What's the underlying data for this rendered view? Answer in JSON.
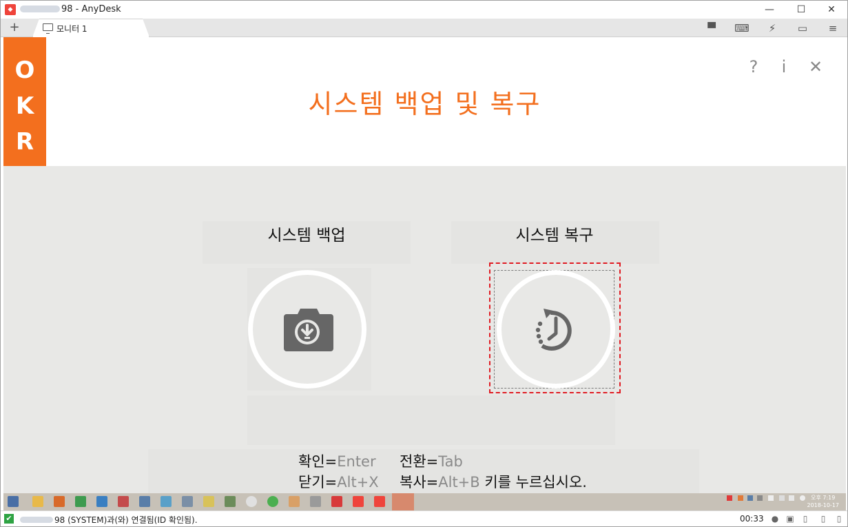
{
  "window": {
    "title_suffix": "98 - AnyDesk",
    "minimize": "—",
    "maximize": "☐",
    "close": "✕"
  },
  "tabs": {
    "add": "+",
    "items": [
      {
        "label": "모니터 1"
      }
    ]
  },
  "toolbar": {
    "chat": "▀",
    "keyboard": "⌨",
    "actions": "⚡",
    "display": "▭",
    "menu": "≡"
  },
  "app": {
    "logo_letters": [
      "O",
      "K",
      "R"
    ],
    "title": "시스템 백업 및 복구",
    "help": "?",
    "info": "i",
    "close": "✕",
    "options": [
      {
        "label": "시스템 백업",
        "icon": "camera-download-icon"
      },
      {
        "label": "시스템 복구",
        "icon": "clock-restore-icon"
      }
    ],
    "hints": {
      "line1_a_label": "확인=",
      "line1_a_key": "Enter",
      "line1_b_label": "전환=",
      "line1_b_key": "Tab",
      "line2_a_label": "닫기=",
      "line2_a_key": "Alt+X",
      "line2_b_label": "복사=",
      "line2_b_key": "Alt+B",
      "line2_suffix": " 키를 누르십시오."
    }
  },
  "taskbar": {
    "clock_time": "오후 7:19",
    "clock_date": "2018-10-17"
  },
  "status": {
    "text": "98 (SYSTEM)과(와) 연결됨(ID 확인됨).",
    "timer": "00:33"
  },
  "colors": {
    "accent": "#f36f1e",
    "focus": "#e01b22",
    "anydesk": "#ef443b"
  }
}
